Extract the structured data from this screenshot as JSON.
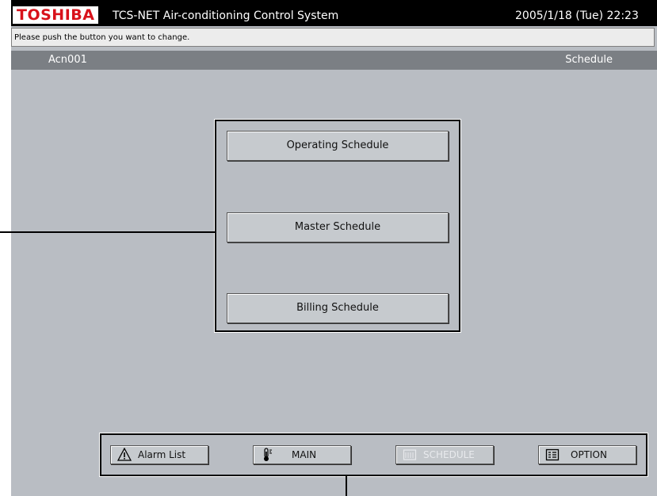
{
  "header": {
    "logo": "TOSHIBA",
    "app_title": "TCS-NET Air-conditioning Control System",
    "datetime": "2005/1/18 (Tue)  22:23"
  },
  "message": "Please push the button you want to change.",
  "status": {
    "unit": "Acn001",
    "screen": "Schedule"
  },
  "schedule_menu": {
    "operating": "Operating Schedule",
    "master": "Master Schedule",
    "billing": "Billing Schedule"
  },
  "nav": {
    "alarm": {
      "label": "Alarm List",
      "icon": "warning-icon"
    },
    "main": {
      "label": "MAIN",
      "icon": "thermometer-icon"
    },
    "schedule": {
      "label": "SCHEDULE",
      "icon": "calendar-icon",
      "disabled": true
    },
    "option": {
      "label": "OPTION",
      "icon": "list-icon"
    }
  },
  "colors": {
    "brand": "#d8121b",
    "background": "#b9bdc3",
    "button": "#c6cace"
  }
}
